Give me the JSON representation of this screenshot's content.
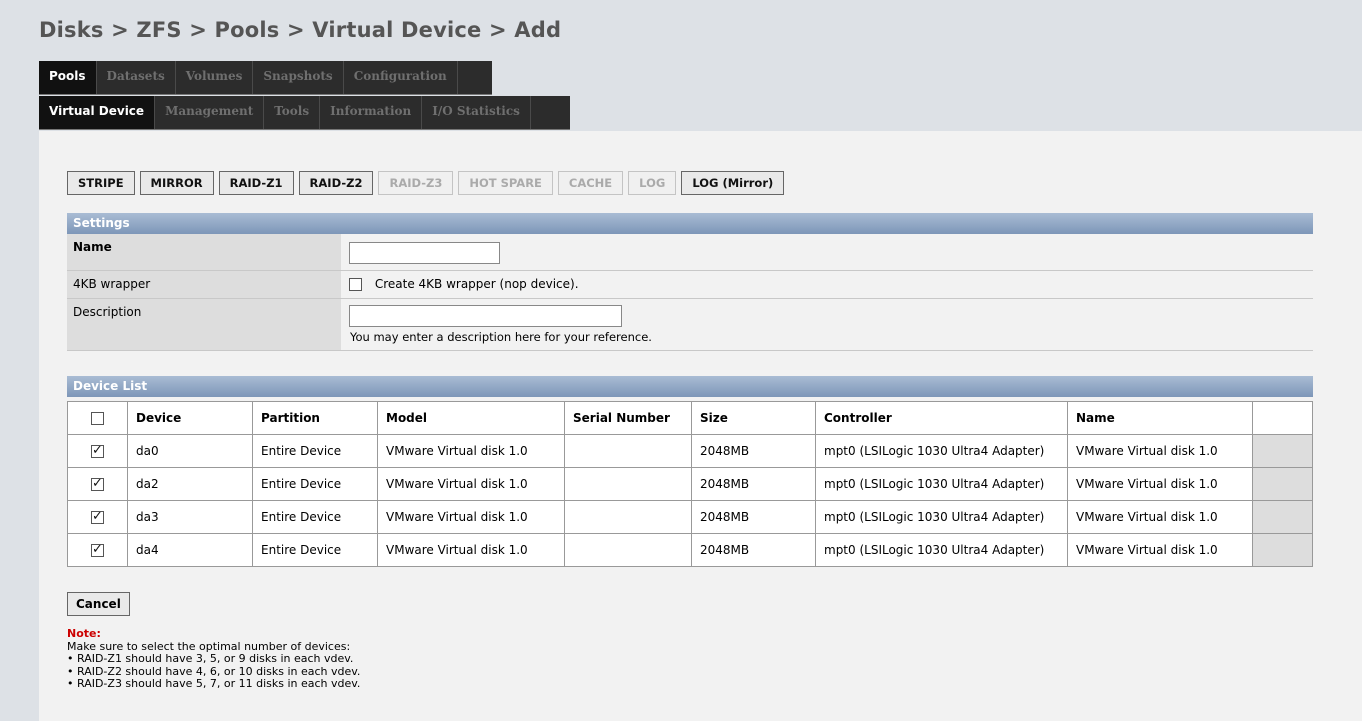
{
  "breadcrumb": "Disks > ZFS > Pools > Virtual Device > Add",
  "tabs_primary": [
    "Pools",
    "Datasets",
    "Volumes",
    "Snapshots",
    "Configuration"
  ],
  "tabs_secondary": [
    "Virtual Device",
    "Management",
    "Tools",
    "Information",
    "I/O Statistics"
  ],
  "vdev_types": [
    {
      "label": "STRIPE",
      "enabled": true
    },
    {
      "label": "MIRROR",
      "enabled": true
    },
    {
      "label": "RAID-Z1",
      "enabled": true
    },
    {
      "label": "RAID-Z2",
      "enabled": true
    },
    {
      "label": "RAID-Z3",
      "enabled": false
    },
    {
      "label": "HOT SPARE",
      "enabled": false
    },
    {
      "label": "CACHE",
      "enabled": false
    },
    {
      "label": "LOG",
      "enabled": false
    },
    {
      "label": "LOG (Mirror)",
      "enabled": true
    }
  ],
  "settings": {
    "header": "Settings",
    "name_label": "Name",
    "name_value": "",
    "wrapper_label": "4KB wrapper",
    "wrapper_text": "Create 4KB wrapper (nop device).",
    "description_label": "Description",
    "description_value": "",
    "description_hint": "You may enter a description here for your reference."
  },
  "device_list": {
    "header": "Device List",
    "columns": [
      "Device",
      "Partition",
      "Model",
      "Serial Number",
      "Size",
      "Controller",
      "Name"
    ],
    "rows": [
      {
        "checked": true,
        "device": "da0",
        "partition": "Entire Device",
        "model": "VMware Virtual disk 1.0",
        "serial": "",
        "size": "2048MB",
        "controller": "mpt0 (LSILogic 1030 Ultra4 Adapter)",
        "name": "VMware Virtual disk 1.0"
      },
      {
        "checked": true,
        "device": "da2",
        "partition": "Entire Device",
        "model": "VMware Virtual disk 1.0",
        "serial": "",
        "size": "2048MB",
        "controller": "mpt0 (LSILogic 1030 Ultra4 Adapter)",
        "name": "VMware Virtual disk 1.0"
      },
      {
        "checked": true,
        "device": "da3",
        "partition": "Entire Device",
        "model": "VMware Virtual disk 1.0",
        "serial": "",
        "size": "2048MB",
        "controller": "mpt0 (LSILogic 1030 Ultra4 Adapter)",
        "name": "VMware Virtual disk 1.0"
      },
      {
        "checked": true,
        "device": "da4",
        "partition": "Entire Device",
        "model": "VMware Virtual disk 1.0",
        "serial": "",
        "size": "2048MB",
        "controller": "mpt0 (LSILogic 1030 Ultra4 Adapter)",
        "name": "VMware Virtual disk 1.0"
      }
    ]
  },
  "cancel_label": "Cancel",
  "note": {
    "title": "Note:",
    "intro": "Make sure to select the optimal number of devices:",
    "items": [
      "RAID-Z1 should have 3, 5, or 9 disks in each vdev.",
      "RAID-Z2 should have 4, 6, or 10 disks in each vdev.",
      "RAID-Z3 should have 5, 7, or 11 disks in each vdev."
    ]
  }
}
